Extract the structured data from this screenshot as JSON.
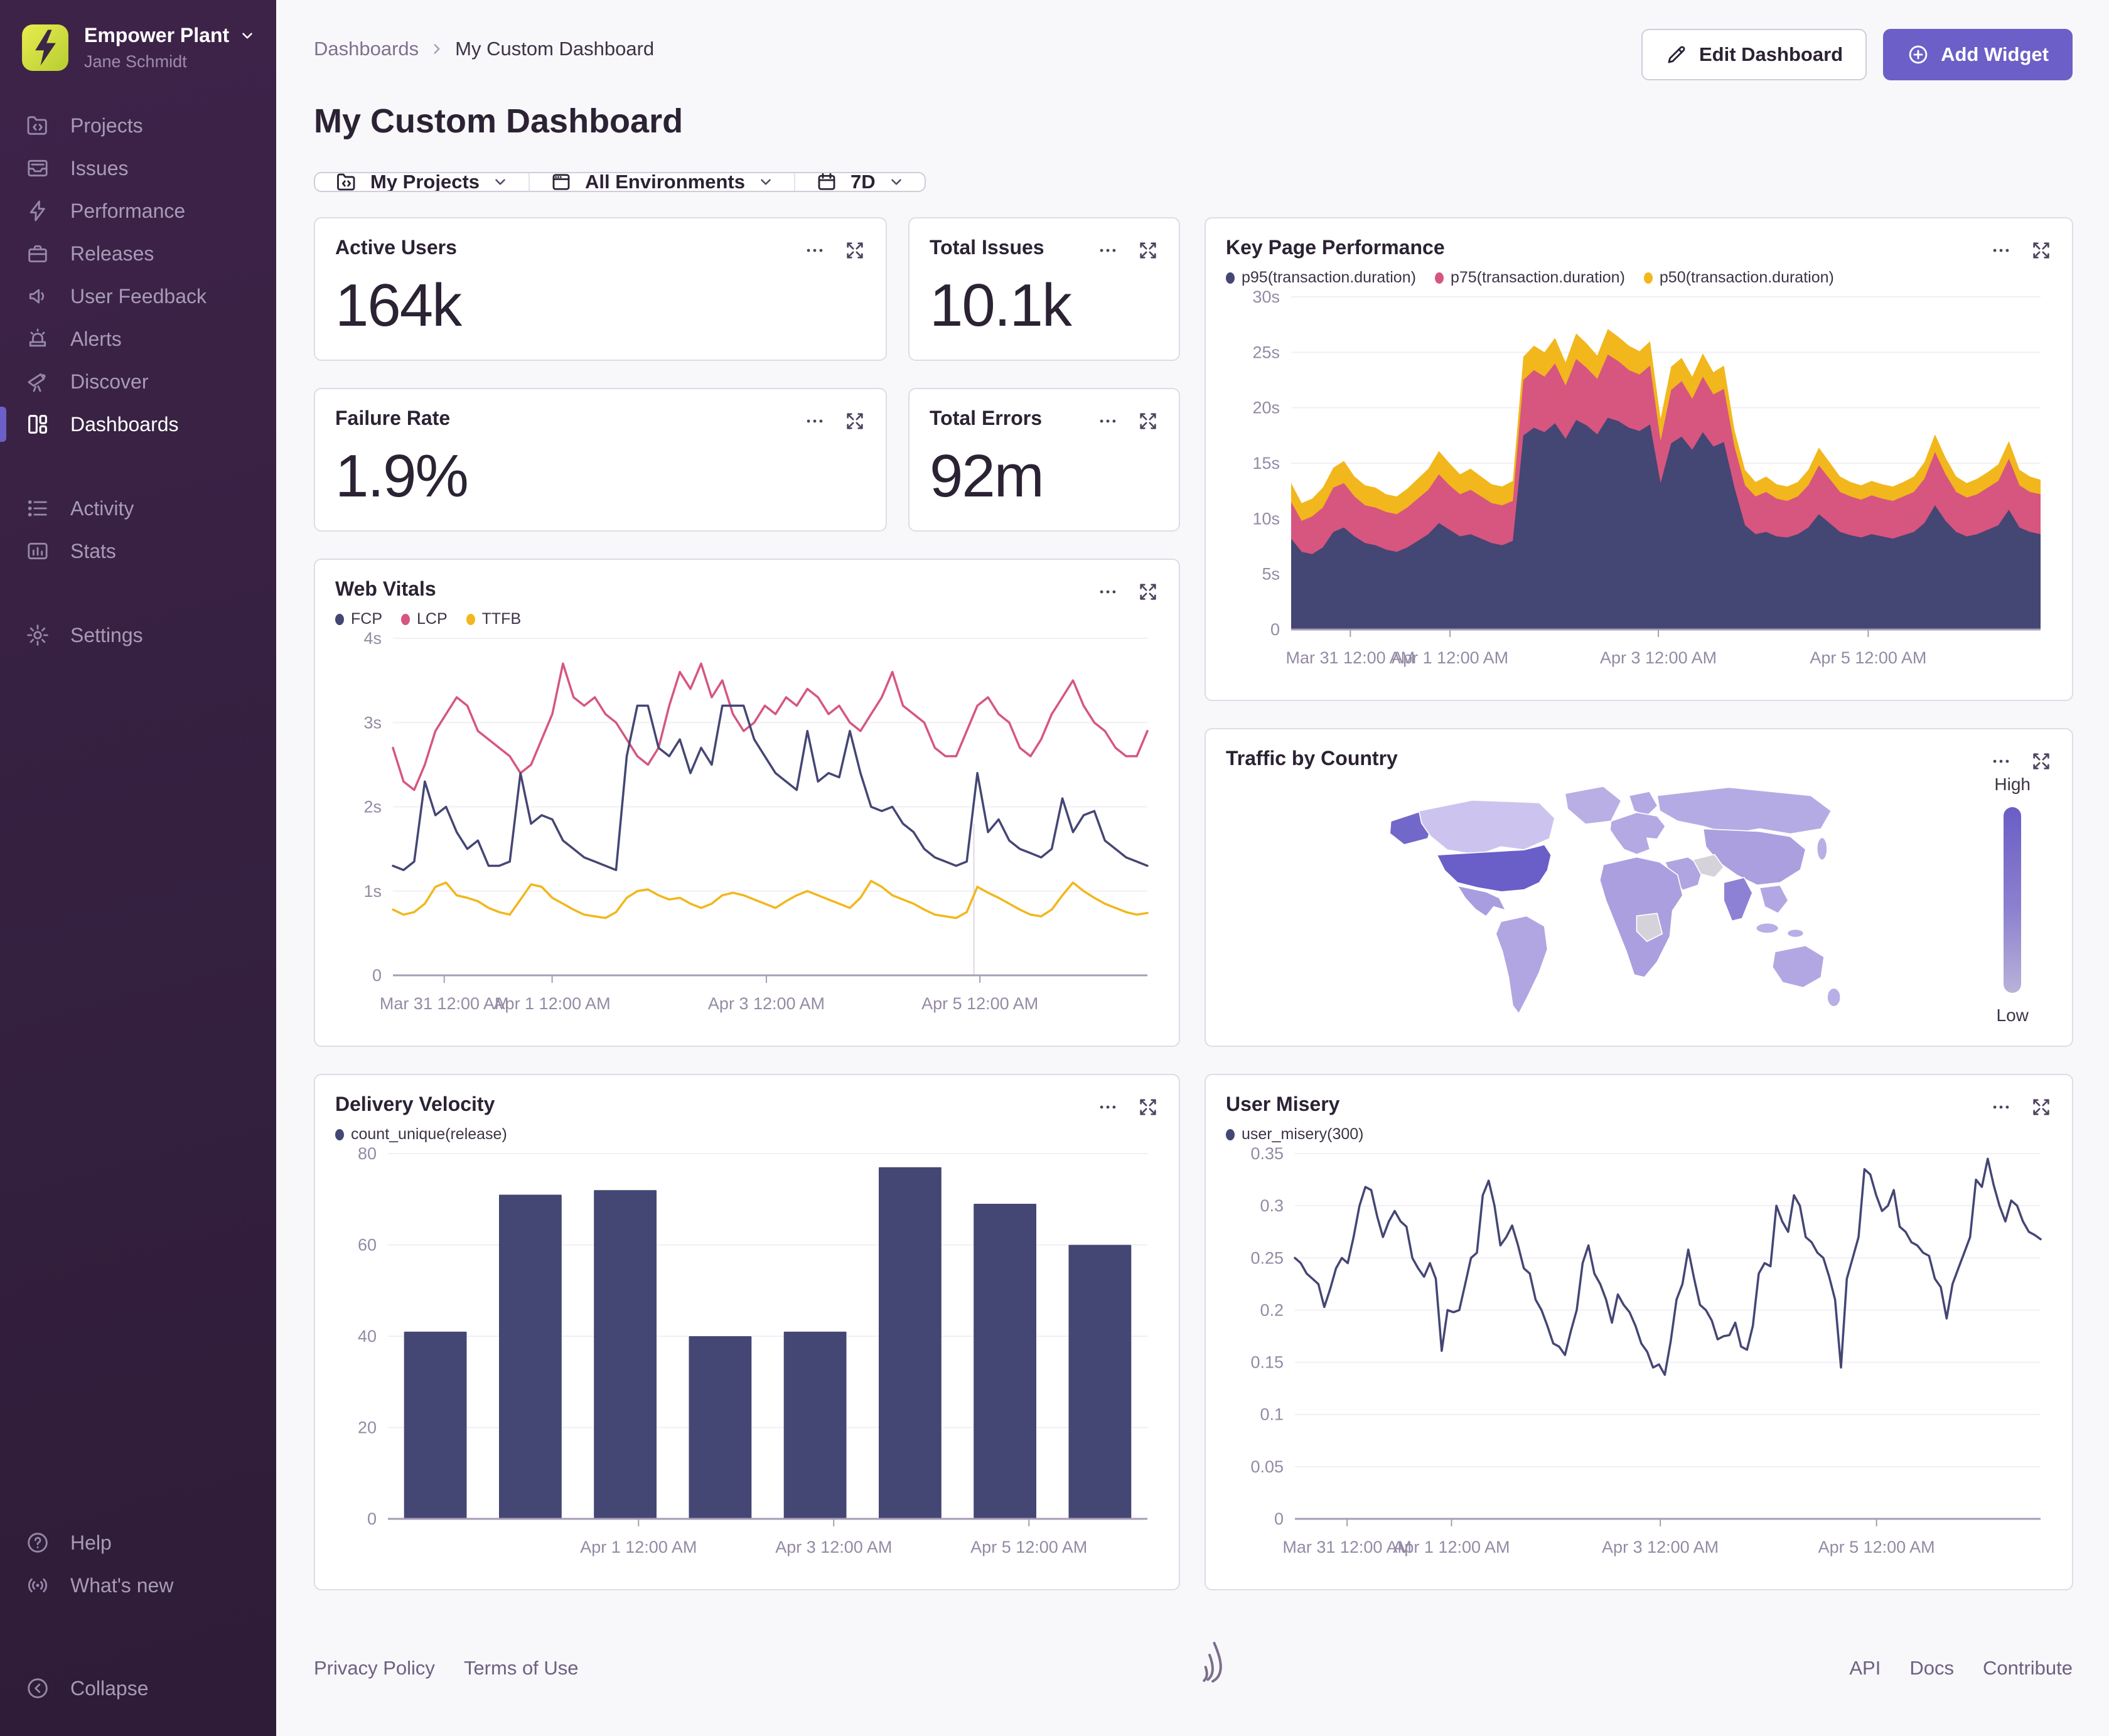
{
  "sidebar": {
    "org": "Empower Plant",
    "user": "Jane Schmidt",
    "items": [
      {
        "label": "Projects"
      },
      {
        "label": "Issues"
      },
      {
        "label": "Performance"
      },
      {
        "label": "Releases"
      },
      {
        "label": "User Feedback"
      },
      {
        "label": "Alerts"
      },
      {
        "label": "Discover"
      },
      {
        "label": "Dashboards",
        "active": true
      },
      {
        "label": "Activity"
      },
      {
        "label": "Stats"
      },
      {
        "label": "Settings"
      }
    ],
    "footer_items": [
      {
        "label": "Help"
      },
      {
        "label": "What's new"
      },
      {
        "label": "Collapse"
      }
    ]
  },
  "header": {
    "breadcrumb_root": "Dashboards",
    "breadcrumb_current": "My Custom Dashboard",
    "title": "My Custom Dashboard",
    "edit_label": "Edit Dashboard",
    "add_label": "Add Widget"
  },
  "filters": {
    "projects": "My Projects",
    "environments": "All Environments",
    "date_range": "7D"
  },
  "widgets": {
    "active_users": {
      "title": "Active Users",
      "value": "164k"
    },
    "total_issues": {
      "title": "Total Issues",
      "value": "10.1k"
    },
    "failure_rate": {
      "title": "Failure Rate",
      "value": "1.9%"
    },
    "total_errors": {
      "title": "Total Errors",
      "value": "92m"
    },
    "key_page_performance": {
      "title": "Key Page Performance",
      "legend": [
        {
          "label": "p95(transaction.duration)",
          "color": "#444674"
        },
        {
          "label": "p75(transaction.duration)",
          "color": "#d6567f"
        },
        {
          "label": "p50(transaction.duration)",
          "color": "#f1b71c"
        }
      ]
    },
    "web_vitals": {
      "title": "Web Vitals",
      "legend": [
        {
          "label": "FCP",
          "color": "#444674"
        },
        {
          "label": "LCP",
          "color": "#d6567f"
        },
        {
          "label": "TTFB",
          "color": "#f1b71c"
        }
      ]
    },
    "traffic": {
      "title": "Traffic by Country"
    },
    "delivery_velocity": {
      "title": "Delivery Velocity",
      "legend": [
        {
          "label": "count_unique(release)",
          "color": "#444674"
        }
      ]
    },
    "user_misery": {
      "title": "User Misery",
      "legend": [
        {
          "label": "user_misery(300)",
          "color": "#444674"
        }
      ]
    }
  },
  "footer": {
    "left": [
      "Privacy Policy",
      "Terms of Use"
    ],
    "right": [
      "API",
      "Docs",
      "Contribute"
    ]
  },
  "colors": {
    "accent": "#6c5fc7",
    "chart_navy": "#444674",
    "chart_pink": "#d6567f",
    "chart_yellow": "#f1b71c",
    "map_high": "#6a5dc6",
    "map_low": "#b9b2d8"
  },
  "chart_data": [
    {
      "id": "kpp",
      "type": "area",
      "title": "Key Page Performance",
      "note": "stacked-look area chart, p50 band on top of p75 on top of p95; values are the visible top edge of each colored band in seconds",
      "ylim": [
        0,
        30
      ],
      "ml": 104,
      "yticks": [
        {
          "v": 0,
          "label": "0"
        },
        {
          "v": 5,
          "label": "5s"
        },
        {
          "v": 10,
          "label": "10s"
        },
        {
          "v": 15,
          "label": "15s"
        },
        {
          "v": 20,
          "label": "20s"
        },
        {
          "v": 25,
          "label": "25s"
        },
        {
          "v": 30,
          "label": "30s"
        }
      ],
      "xticks": [
        {
          "p": 0.079,
          "label": "Mar 31 12:00 AM"
        },
        {
          "p": 0.212,
          "label": "Apr 1 12:00 AM"
        },
        {
          "p": 0.49,
          "label": "Apr 3 12:00 AM"
        },
        {
          "p": 0.77,
          "label": "Apr 5 12:00 AM"
        }
      ],
      "series": [
        {
          "name": "p50(transaction.duration)",
          "color": "#f1b71c",
          "values": [
            13.2,
            11.4,
            11.8,
            12.8,
            14.6,
            15.2,
            13.8,
            13.0,
            12.8,
            12.2,
            12.0,
            12.7,
            13.6,
            14.5,
            16.1,
            15.0,
            14.0,
            14.5,
            13.8,
            13.1,
            12.9,
            13.4,
            24.6,
            25.6,
            25.0,
            26.3,
            24.1,
            26.7,
            25.8,
            24.7,
            27.1,
            26.4,
            25.6,
            25.1,
            26.0,
            19.0,
            23.7,
            24.5,
            22.8,
            24.9,
            23.2,
            23.8,
            18.0,
            14.4,
            13.3,
            13.8,
            13.1,
            12.9,
            13.3,
            14.4,
            16.4,
            15.1,
            13.8,
            13.3,
            13.0,
            13.4,
            13.1,
            12.9,
            13.3,
            13.8,
            15.1,
            17.6,
            15.5,
            13.8,
            13.2,
            13.6,
            14.2,
            14.9,
            17.0,
            14.4,
            13.8,
            13.5
          ]
        },
        {
          "name": "p75(transaction.duration)",
          "color": "#d6567f",
          "values": [
            11.5,
            9.8,
            10.2,
            11.0,
            12.8,
            13.2,
            12.0,
            11.2,
            11.0,
            10.6,
            10.4,
            11.0,
            11.8,
            12.6,
            14.0,
            13.0,
            12.2,
            12.6,
            12.0,
            11.4,
            11.2,
            11.6,
            22.5,
            23.4,
            22.8,
            24.0,
            22.0,
            24.4,
            23.6,
            22.6,
            24.8,
            24.2,
            23.4,
            23.0,
            23.8,
            17.0,
            21.6,
            22.4,
            20.8,
            22.8,
            21.2,
            21.7,
            16.5,
            13.0,
            12.0,
            12.4,
            11.8,
            11.6,
            12.0,
            13.0,
            14.8,
            13.6,
            12.4,
            12.0,
            11.7,
            12.1,
            11.8,
            11.6,
            12.0,
            12.4,
            13.6,
            16.0,
            14.0,
            12.4,
            11.9,
            12.2,
            12.8,
            13.4,
            15.4,
            13.0,
            12.4,
            12.2
          ]
        },
        {
          "name": "p95(transaction.duration)",
          "color": "#444674",
          "values": [
            8.2,
            7.0,
            6.8,
            7.4,
            8.8,
            9.2,
            8.4,
            7.8,
            7.6,
            7.2,
            7.0,
            7.4,
            8.0,
            8.6,
            9.6,
            9.0,
            8.4,
            8.6,
            8.2,
            7.8,
            7.6,
            8.0,
            17.5,
            18.2,
            17.8,
            18.6,
            17.2,
            18.9,
            18.4,
            17.6,
            19.1,
            18.8,
            18.2,
            17.9,
            18.5,
            13.2,
            16.8,
            17.4,
            16.2,
            17.8,
            16.5,
            16.9,
            12.8,
            9.4,
            8.6,
            8.8,
            8.4,
            8.3,
            8.6,
            9.2,
            10.4,
            9.6,
            8.8,
            8.5,
            8.3,
            8.6,
            8.4,
            8.2,
            8.5,
            8.8,
            9.6,
            11.2,
            9.8,
            8.8,
            8.4,
            8.6,
            9.0,
            9.4,
            10.8,
            9.2,
            8.8,
            8.6
          ]
        }
      ]
    },
    {
      "id": "web_vitals",
      "type": "line",
      "title": "Web Vitals",
      "ylim": [
        0,
        4
      ],
      "ml": 92,
      "vline": 0.77,
      "yticks": [
        {
          "v": 0,
          "label": "0"
        },
        {
          "v": 1,
          "label": "1s"
        },
        {
          "v": 2,
          "label": "2s"
        },
        {
          "v": 3,
          "label": "3s"
        },
        {
          "v": 4,
          "label": "4s"
        }
      ],
      "xticks": [
        {
          "p": 0.068,
          "label": "Mar 31 12:00 AM"
        },
        {
          "p": 0.211,
          "label": "Apr 1 12:00 AM"
        },
        {
          "p": 0.495,
          "label": "Apr 3 12:00 AM"
        },
        {
          "p": 0.778,
          "label": "Apr 5 12:00 AM"
        }
      ],
      "series": [
        {
          "name": "LCP",
          "color": "#d6567f",
          "values": [
            2.7,
            2.3,
            2.2,
            2.5,
            2.9,
            3.1,
            3.3,
            3.2,
            2.9,
            2.8,
            2.7,
            2.6,
            2.4,
            2.5,
            2.8,
            3.1,
            3.7,
            3.3,
            3.2,
            3.3,
            3.1,
            3.0,
            2.8,
            2.6,
            2.5,
            2.7,
            3.2,
            3.6,
            3.4,
            3.7,
            3.3,
            3.5,
            3.1,
            2.9,
            3.0,
            3.2,
            3.1,
            3.3,
            3.2,
            3.4,
            3.3,
            3.1,
            3.2,
            3.0,
            2.9,
            3.1,
            3.3,
            3.6,
            3.2,
            3.1,
            3.0,
            2.7,
            2.6,
            2.6,
            2.9,
            3.2,
            3.3,
            3.1,
            3.0,
            2.7,
            2.6,
            2.8,
            3.1,
            3.3,
            3.5,
            3.2,
            3.0,
            2.9,
            2.7,
            2.6,
            2.6,
            2.9
          ]
        },
        {
          "name": "FCP",
          "color": "#444674",
          "values": [
            1.3,
            1.25,
            1.35,
            2.3,
            1.9,
            2.0,
            1.7,
            1.5,
            1.6,
            1.3,
            1.3,
            1.35,
            2.4,
            1.8,
            1.9,
            1.85,
            1.6,
            1.5,
            1.4,
            1.35,
            1.3,
            1.25,
            2.6,
            3.2,
            3.2,
            2.7,
            2.6,
            2.8,
            2.4,
            2.7,
            2.5,
            3.2,
            3.2,
            3.2,
            2.8,
            2.6,
            2.4,
            2.3,
            2.2,
            2.9,
            2.3,
            2.4,
            2.35,
            2.9,
            2.4,
            2.0,
            1.95,
            2.0,
            1.8,
            1.7,
            1.5,
            1.4,
            1.35,
            1.3,
            1.35,
            2.4,
            1.7,
            1.85,
            1.6,
            1.5,
            1.45,
            1.4,
            1.5,
            2.1,
            1.7,
            1.9,
            1.95,
            1.6,
            1.5,
            1.4,
            1.35,
            1.3
          ]
        },
        {
          "name": "TTFB",
          "color": "#f1b71c",
          "values": [
            0.78,
            0.72,
            0.75,
            0.85,
            1.05,
            1.1,
            0.95,
            0.92,
            0.88,
            0.8,
            0.75,
            0.72,
            0.9,
            1.08,
            1.05,
            0.92,
            0.85,
            0.78,
            0.72,
            0.7,
            0.68,
            0.75,
            0.92,
            1.0,
            1.02,
            0.95,
            0.9,
            0.92,
            0.85,
            0.8,
            0.85,
            0.95,
            0.98,
            0.95,
            0.9,
            0.85,
            0.8,
            0.88,
            0.95,
            1.0,
            0.95,
            0.9,
            0.85,
            0.8,
            0.92,
            1.12,
            1.05,
            0.95,
            0.9,
            0.85,
            0.78,
            0.72,
            0.7,
            0.68,
            0.75,
            1.05,
            0.98,
            0.92,
            0.85,
            0.78,
            0.72,
            0.7,
            0.78,
            0.95,
            1.1,
            1.0,
            0.92,
            0.85,
            0.8,
            0.75,
            0.72,
            0.74
          ]
        }
      ]
    },
    {
      "id": "traffic",
      "type": "choropleth",
      "title": "Traffic by Country",
      "legend_high": "High",
      "legend_low": "Low",
      "highlight": "United States"
    },
    {
      "id": "delivery_velocity",
      "type": "bar",
      "title": "Delivery Velocity",
      "ylim": [
        0,
        80
      ],
      "ml": 84,
      "color": "#444674",
      "values": [
        41,
        71,
        72,
        40,
        41,
        77,
        69,
        60
      ],
      "yticks": [
        {
          "v": 0,
          "label": "0"
        },
        {
          "v": 20,
          "label": "20"
        },
        {
          "v": 40,
          "label": "40"
        },
        {
          "v": 60,
          "label": "60"
        },
        {
          "v": 80,
          "label": "80"
        }
      ],
      "xticks": [
        {
          "p": 0.33,
          "label": "Apr 1 12:00 AM"
        },
        {
          "p": 0.587,
          "label": "Apr 3 12:00 AM"
        },
        {
          "p": 0.844,
          "label": "Apr 5 12:00 AM"
        }
      ]
    },
    {
      "id": "user_misery",
      "type": "line",
      "title": "User Misery",
      "ylim": [
        0,
        0.35
      ],
      "ml": 110,
      "yticks": [
        {
          "v": 0,
          "label": "0"
        },
        {
          "v": 0.05,
          "label": "0.05"
        },
        {
          "v": 0.1,
          "label": "0.1"
        },
        {
          "v": 0.15,
          "label": "0.15"
        },
        {
          "v": 0.2,
          "label": "0.2"
        },
        {
          "v": 0.25,
          "label": "0.25"
        },
        {
          "v": 0.3,
          "label": "0.3"
        },
        {
          "v": 0.35,
          "label": "0.35"
        }
      ],
      "xticks": [
        {
          "p": 0.07,
          "label": "Mar 31 12:00 AM"
        },
        {
          "p": 0.21,
          "label": "Apr 1 12:00 AM"
        },
        {
          "p": 0.49,
          "label": "Apr 3 12:00 AM"
        },
        {
          "p": 0.78,
          "label": "Apr 5 12:00 AM"
        }
      ],
      "series": [
        {
          "name": "user_misery(300)",
          "color": "#444674",
          "values": [
            0.25,
            0.245,
            0.235,
            0.23,
            0.225,
            0.203,
            0.22,
            0.24,
            0.25,
            0.245,
            0.27,
            0.3,
            0.318,
            0.315,
            0.29,
            0.27,
            0.285,
            0.295,
            0.285,
            0.28,
            0.25,
            0.24,
            0.232,
            0.245,
            0.23,
            0.161,
            0.2,
            0.198,
            0.2,
            0.225,
            0.25,
            0.255,
            0.31,
            0.324,
            0.3,
            0.262,
            0.27,
            0.281,
            0.262,
            0.24,
            0.235,
            0.21,
            0.2,
            0.185,
            0.168,
            0.165,
            0.157,
            0.18,
            0.2,
            0.245,
            0.262,
            0.235,
            0.225,
            0.21,
            0.188,
            0.215,
            0.205,
            0.198,
            0.185,
            0.168,
            0.16,
            0.145,
            0.148,
            0.138,
            0.17,
            0.21,
            0.225,
            0.258,
            0.23,
            0.205,
            0.2,
            0.19,
            0.172,
            0.175,
            0.176,
            0.188,
            0.165,
            0.162,
            0.185,
            0.235,
            0.245,
            0.242,
            0.3,
            0.285,
            0.275,
            0.31,
            0.3,
            0.27,
            0.265,
            0.255,
            0.25,
            0.232,
            0.21,
            0.145,
            0.23,
            0.25,
            0.27,
            0.335,
            0.33,
            0.31,
            0.295,
            0.3,
            0.315,
            0.28,
            0.275,
            0.265,
            0.262,
            0.255,
            0.252,
            0.23,
            0.222,
            0.192,
            0.225,
            0.24,
            0.255,
            0.27,
            0.325,
            0.318,
            0.345,
            0.32,
            0.3,
            0.285,
            0.305,
            0.3,
            0.285,
            0.275,
            0.272,
            0.268
          ]
        }
      ]
    }
  ]
}
